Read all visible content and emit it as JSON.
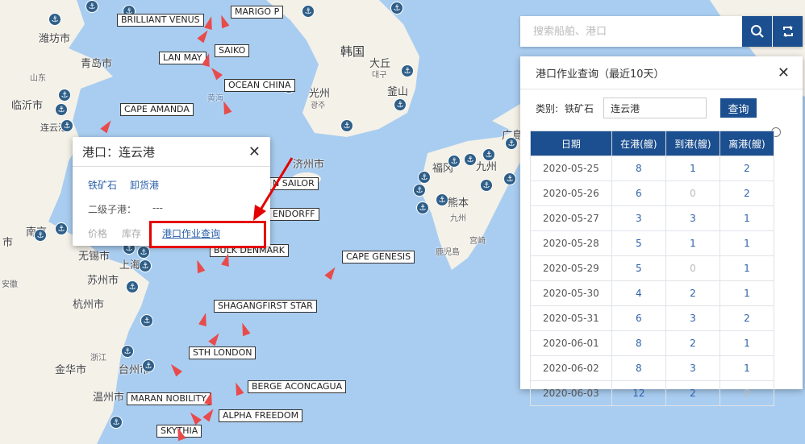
{
  "map": {
    "places": [
      {
        "name": "潍坊市",
        "cls": ""
      },
      {
        "name": "青岛市",
        "cls": ""
      },
      {
        "name": "山东",
        "cls": "small"
      },
      {
        "name": "临沂市",
        "cls": ""
      },
      {
        "name": "连云港",
        "cls": ""
      },
      {
        "name": "韩国",
        "cls": "big"
      },
      {
        "name": "光州",
        "cls": ""
      },
      {
        "name": "광주",
        "cls": "small"
      },
      {
        "name": "大丘",
        "cls": ""
      },
      {
        "name": "대구",
        "cls": "small"
      },
      {
        "name": "釜山",
        "cls": ""
      },
      {
        "name": "济州市",
        "cls": ""
      },
      {
        "name": "南京",
        "cls": ""
      },
      {
        "name": "无锡市",
        "cls": ""
      },
      {
        "name": "苏州市",
        "cls": ""
      },
      {
        "name": "上海",
        "cls": ""
      },
      {
        "name": "杭州市",
        "cls": ""
      },
      {
        "name": "安徽",
        "cls": "small"
      },
      {
        "name": "浙江",
        "cls": "small"
      },
      {
        "name": "金华市",
        "cls": ""
      },
      {
        "name": "台州市",
        "cls": ""
      },
      {
        "name": "温州市",
        "cls": ""
      },
      {
        "name": "福冈",
        "cls": ""
      },
      {
        "name": "九州",
        "cls": ""
      },
      {
        "name": "熊本",
        "cls": ""
      },
      {
        "name": "九州",
        "cls": "small"
      },
      {
        "name": "宫崎",
        "cls": "small"
      },
      {
        "name": "鹿児島",
        "cls": "small"
      },
      {
        "name": "黄海",
        "cls": "small"
      },
      {
        "name": "市",
        "cls": ""
      },
      {
        "name": "广島",
        "cls": ""
      }
    ],
    "ships": [
      "BRILLIANT VENUS",
      "MARIGO P",
      "LAN MAY",
      "SAIKO",
      "OCEAN CHINA",
      "CAPE AMANDA",
      "N SAILOR",
      "ENDORFF",
      "BULK DENMARK",
      "CAPE GENESIS",
      "SHAGANGFIRST STAR",
      "STH LONDON",
      "BERGE ACONCAGUA",
      "MARAN NOBILITY",
      "ALPHA FREEDOM",
      "SKYTHIA"
    ]
  },
  "port_popup": {
    "title": "港口：连云港",
    "cargo_links": [
      "铁矿石",
      "卸货港"
    ],
    "sub_port_label": "二级子港：",
    "sub_port_value": "---",
    "tabs": [
      "价格",
      "库存"
    ],
    "query_link": "港口作业查询"
  },
  "search": {
    "placeholder": "搜索船舶、港口"
  },
  "query_panel": {
    "title": "港口作业查询（最近10天）",
    "category_label": "类别:",
    "category_value": "铁矿石",
    "port_value": "连云港",
    "query_button": "查询",
    "columns": [
      "日期",
      "在港(艘)",
      "到港(艘)",
      "离港(艘)"
    ],
    "rows": [
      [
        "2020-05-25",
        "8",
        "1",
        "2"
      ],
      [
        "2020-05-26",
        "6",
        "0",
        "2"
      ],
      [
        "2020-05-27",
        "3",
        "3",
        "1"
      ],
      [
        "2020-05-28",
        "5",
        "1",
        "1"
      ],
      [
        "2020-05-29",
        "5",
        "0",
        "1"
      ],
      [
        "2020-05-30",
        "4",
        "2",
        "1"
      ],
      [
        "2020-05-31",
        "6",
        "3",
        "2"
      ],
      [
        "2020-06-01",
        "8",
        "2",
        "1"
      ],
      [
        "2020-06-02",
        "8",
        "3",
        "1"
      ],
      [
        "2020-06-03",
        "12",
        "2",
        "0"
      ]
    ]
  },
  "colors": {
    "accent": "#1c4f8f",
    "highlight": "#e40000",
    "ship": "#e84b4b",
    "sea": "#a9cdf0",
    "land": "#f4f1e8"
  },
  "icons": [
    "search-icon",
    "refresh-icon",
    "close-icon",
    "anchor-icon",
    "ship-icon"
  ]
}
